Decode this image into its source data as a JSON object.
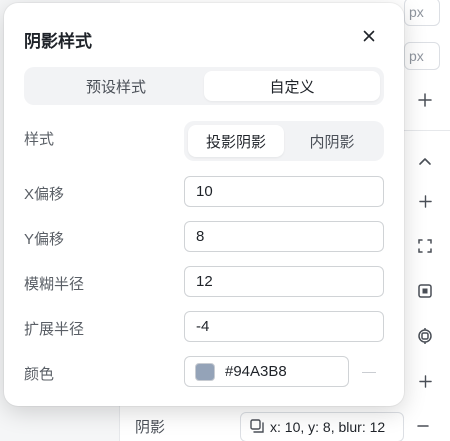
{
  "background": {
    "unit_label_1": "px",
    "unit_label_2": "px",
    "shadow_label": "阴影",
    "shadow_summary": "x: 10, y: 8, blur: 12",
    "icons": [
      "plus-icon",
      "chevron-up-icon",
      "plus-icon",
      "expand-icon",
      "fit-icon",
      "ring-icon",
      "plus-icon",
      "minus-icon"
    ]
  },
  "dialog": {
    "title": "阴影样式",
    "tabs": [
      {
        "label": "预设样式",
        "active": false
      },
      {
        "label": "自定义",
        "active": true
      }
    ],
    "style_label": "样式",
    "style_options": [
      {
        "label": "投影阴影",
        "active": true
      },
      {
        "label": "内阴影",
        "active": false
      }
    ],
    "x_offset": {
      "label": "X偏移",
      "value": "10"
    },
    "y_offset": {
      "label": "Y偏移",
      "value": "8"
    },
    "blur": {
      "label": "模糊半径",
      "value": "12"
    },
    "spread": {
      "label": "扩展半径",
      "value": "-4"
    },
    "color": {
      "label": "颜色",
      "value": "#94A3B8",
      "swatch": "#94A3B8",
      "remove_symbol": "—"
    }
  }
}
